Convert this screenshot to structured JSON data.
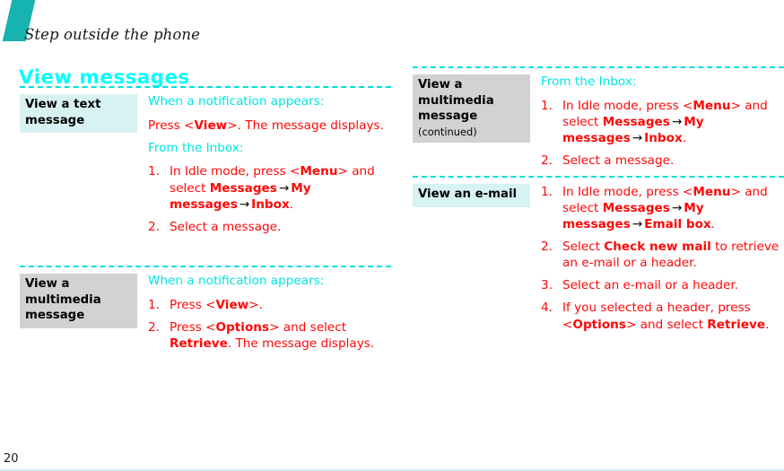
{
  "page": {
    "running_head": "Step outside the phone",
    "section_heading": "View messages",
    "page_number": "20",
    "accent_teal": "#17b3b0",
    "accent_cyan": "#00ffff",
    "body_red": "#ff0707",
    "label_tint_cyan": "#d7f2f2",
    "label_tint_gray": "#d2d2d2",
    "arrow_glyph": "→"
  },
  "left_column": {
    "rows": [
      {
        "label": "View a text message",
        "label_tint": "cyan",
        "lead_1": "When a notification appears:",
        "para_1_a": "Press <",
        "para_1_b": "View",
        "para_1_c": ">. The message displays.",
        "lead_2": "From the Inbox:",
        "steps": [
          {
            "t1": "In Idle mode, press <",
            "b1": "Menu",
            "t2": "> and select ",
            "b2": "Messages",
            "b3": "My messages",
            "b4": "Inbox",
            "t3": "."
          },
          {
            "t1": "Select a message."
          }
        ]
      },
      {
        "label": "View a multimedia message",
        "label_tint": "gray",
        "lead_1": "When a notification appears:",
        "steps": [
          {
            "t1": "Press <",
            "b1": "View",
            "t2": ">."
          },
          {
            "t1": "Press <",
            "b1": "Options",
            "t2": "> and select ",
            "b2": "Retrieve",
            "t3": ". The message displays."
          }
        ]
      }
    ]
  },
  "right_column": {
    "rows": [
      {
        "label": "View a multimedia message",
        "label_continued": "(continued)",
        "label_tint": "gray",
        "lead_1": "From the Inbox:",
        "steps": [
          {
            "t1": "In Idle mode, press <",
            "b1": "Menu",
            "t2": "> and select ",
            "b2": "Messages",
            "b3": "My messages",
            "b4": "Inbox",
            "t3": "."
          },
          {
            "t1": "Select a message."
          }
        ]
      },
      {
        "label": "View an e-mail",
        "label_tint": "cyan",
        "steps": [
          {
            "t1": "In Idle mode, press <",
            "b1": "Menu",
            "t2": "> and select ",
            "b2": "Messages",
            "b3": "My messages",
            "b4": "Email box",
            "t3": "."
          },
          {
            "t1": "Select ",
            "b1": "Check new mail",
            "t2": " to retrieve an e-mail or a header."
          },
          {
            "t1": "Select an e-mail or a header."
          },
          {
            "t1": "If you selected a header, press <",
            "b1": "Options",
            "t2": "> and select ",
            "b2": "Retrieve",
            "t3": "."
          }
        ]
      }
    ]
  }
}
